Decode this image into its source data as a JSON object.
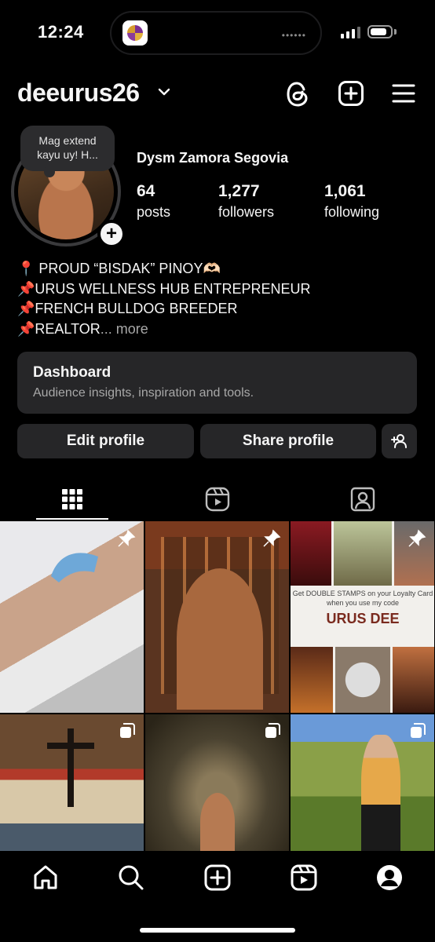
{
  "status_bar": {
    "time": "12:24",
    "dots": "••••••"
  },
  "header": {
    "username": "deeurus26"
  },
  "profile": {
    "note_text": "Mag extend kayu uy! H...",
    "full_name": "Dysm Zamora Segovia",
    "stats": [
      {
        "value": "64",
        "label": "posts"
      },
      {
        "value": "1,277",
        "label": "followers"
      },
      {
        "value": "1,061",
        "label": "following"
      }
    ],
    "bio": [
      "📍 PROUD “BISDAK” PINOY🫶🏻",
      "📌URUS WELLNESS HUB ENTREPRENEUR",
      "📌FRENCH BULLDOG BREEDER",
      "📌REALTOR"
    ],
    "bio_more": "... more"
  },
  "dashboard": {
    "title": "Dashboard",
    "subtitle": "Audience insights, inspiration and tools."
  },
  "actions": {
    "edit": "Edit profile",
    "share": "Share profile"
  },
  "grid": {
    "promo": {
      "line1": "Get DOUBLE STAMPS on your Loyalty Card",
      "line2": "when you use my code",
      "code": "URUS DEE"
    }
  },
  "colors": {
    "background": "#000000",
    "surface": "#262628",
    "muted_text": "#a8a8a8"
  },
  "icons": [
    "threads-icon",
    "create-icon",
    "menu-icon",
    "grid-icon",
    "reels-icon",
    "tagged-icon",
    "home-icon",
    "search-icon",
    "plus-icon",
    "reels-nav-icon",
    "profile-icon"
  ]
}
